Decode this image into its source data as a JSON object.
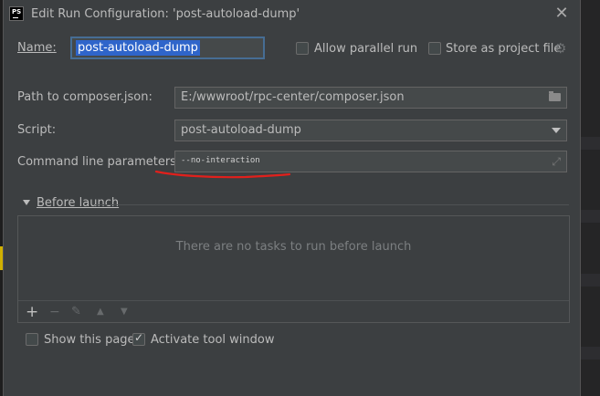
{
  "window": {
    "app_icon_text": "PS",
    "title": "Edit Run Configuration: 'post-autoload-dump'",
    "close_icon": "close-icon"
  },
  "form": {
    "name_label": "Name:",
    "name_value": "post-autoload-dump",
    "allow_parallel_label": "Allow parallel run",
    "allow_parallel_checked": false,
    "store_project_label": "Store as project file",
    "store_project_checked": false,
    "path_label": "Path to composer.json:",
    "path_value": "E:/wwwroot/rpc-center/composer.json",
    "script_label": "Script:",
    "script_value": "post-autoload-dump",
    "params_label": "Command line parameters:",
    "params_value": "--no-interaction"
  },
  "before_launch": {
    "section_label": "Before launch",
    "expanded": true,
    "empty_text": "There are no tasks to run before launch",
    "toolbar": [
      "add-icon",
      "remove-icon",
      "edit-icon",
      "move-up-icon",
      "move-down-icon"
    ]
  },
  "footer": {
    "show_page_label": "Show this page",
    "show_page_checked": false,
    "activate_tool_label": "Activate tool window",
    "activate_tool_checked": true
  },
  "colors": {
    "dialog_bg": "#3c3f41",
    "selection": "#2f65ca",
    "focus_border": "#466d94",
    "annotation_red": "#e0201c"
  }
}
